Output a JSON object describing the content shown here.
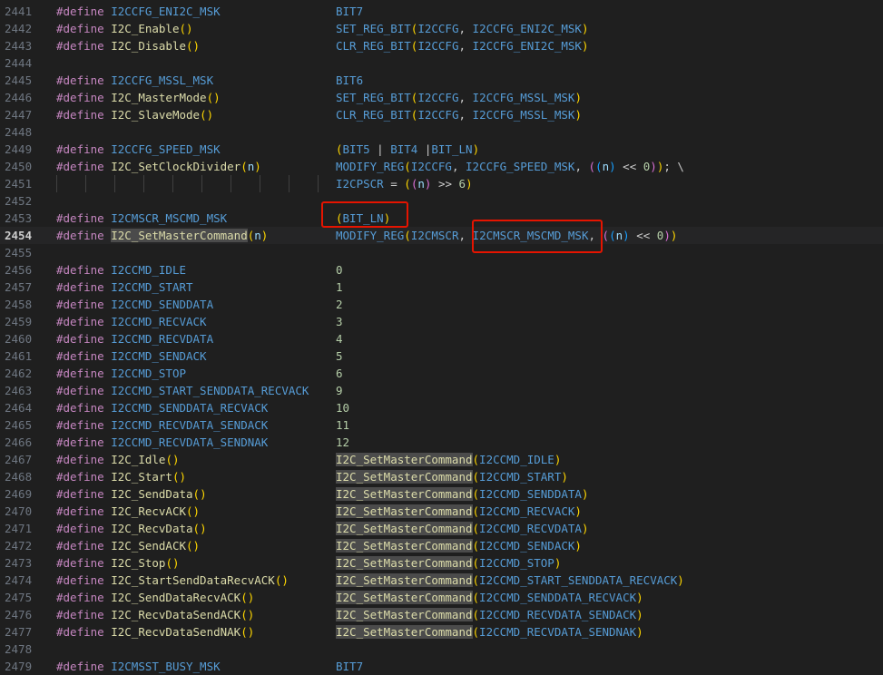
{
  "lines": [
    {
      "no": "2441",
      "name": "I2CCFG_ENI2C_MSK",
      "value": "BIT7"
    },
    {
      "no": "2442",
      "name": "I2C_Enable",
      "args": "()",
      "value": "SET_REG_BIT(I2CCFG, I2CCFG_ENI2C_MSK)"
    },
    {
      "no": "2443",
      "name": "I2C_Disable",
      "args": "()",
      "value": "CLR_REG_BIT(I2CCFG, I2CCFG_ENI2C_MSK)"
    },
    {
      "no": "2444"
    },
    {
      "no": "2445",
      "name": "I2CCFG_MSSL_MSK",
      "value": "BIT6"
    },
    {
      "no": "2446",
      "name": "I2C_MasterMode",
      "args": "()",
      "value": "SET_REG_BIT(I2CCFG, I2CCFG_MSSL_MSK)"
    },
    {
      "no": "2447",
      "name": "I2C_SlaveMode",
      "args": "()",
      "value": "CLR_REG_BIT(I2CCFG, I2CCFG_MSSL_MSK)"
    },
    {
      "no": "2448"
    },
    {
      "no": "2449",
      "name": "I2CCFG_SPEED_MSK",
      "value": "(BIT5 | BIT4 |BIT_LN)"
    },
    {
      "no": "2450",
      "name": "I2C_SetClockDivider",
      "args": "(n)",
      "value": "MODIFY_REG(I2CCFG, I2CCFG_SPEED_MSK, ((n) << 0)); \\"
    },
    {
      "no": "2451",
      "cont": "I2CPSCR = ((n) >> 6)"
    },
    {
      "no": "2452"
    },
    {
      "no": "2453",
      "name": "I2CMSCR_MSCMD_MSK",
      "value": "(BIT_LN)"
    },
    {
      "no": "2454",
      "name": "I2C_SetMasterCommand",
      "args": "(n)",
      "value": "MODIFY_REG(I2CMSCR, I2CMSCR_MSCMD_MSK, ((n) << 0))",
      "current": true
    },
    {
      "no": "2455"
    },
    {
      "no": "2456",
      "name": "I2CCMD_IDLE",
      "value": "0"
    },
    {
      "no": "2457",
      "name": "I2CCMD_START",
      "value": "1"
    },
    {
      "no": "2458",
      "name": "I2CCMD_SENDDATA",
      "value": "2"
    },
    {
      "no": "2459",
      "name": "I2CCMD_RECVACK",
      "value": "3"
    },
    {
      "no": "2460",
      "name": "I2CCMD_RECVDATA",
      "value": "4"
    },
    {
      "no": "2461",
      "name": "I2CCMD_SENDACK",
      "value": "5"
    },
    {
      "no": "2462",
      "name": "I2CCMD_STOP",
      "value": "6"
    },
    {
      "no": "2463",
      "name": "I2CCMD_START_SENDDATA_RECVACK",
      "value": "9"
    },
    {
      "no": "2464",
      "name": "I2CCMD_SENDDATA_RECVACK",
      "value": "10"
    },
    {
      "no": "2465",
      "name": "I2CCMD_RECVDATA_SENDACK",
      "value": "11"
    },
    {
      "no": "2466",
      "name": "I2CCMD_RECVDATA_SENDNAK",
      "value": "12"
    },
    {
      "no": "2467",
      "name": "I2C_Idle",
      "args": "()",
      "value": "I2C_SetMasterCommand(I2CCMD_IDLE)"
    },
    {
      "no": "2468",
      "name": "I2C_Start",
      "args": "()",
      "value": "I2C_SetMasterCommand(I2CCMD_START)"
    },
    {
      "no": "2469",
      "name": "I2C_SendData",
      "args": "()",
      "value": "I2C_SetMasterCommand(I2CCMD_SENDDATA)"
    },
    {
      "no": "2470",
      "name": "I2C_RecvACK",
      "args": "()",
      "value": "I2C_SetMasterCommand(I2CCMD_RECVACK)"
    },
    {
      "no": "2471",
      "name": "I2C_RecvData",
      "args": "()",
      "value": "I2C_SetMasterCommand(I2CCMD_RECVDATA)"
    },
    {
      "no": "2472",
      "name": "I2C_SendACK",
      "args": "()",
      "value": "I2C_SetMasterCommand(I2CCMD_SENDACK)"
    },
    {
      "no": "2473",
      "name": "I2C_Stop",
      "args": "()",
      "value": "I2C_SetMasterCommand(I2CCMD_STOP)"
    },
    {
      "no": "2474",
      "name": "I2C_StartSendDataRecvACK",
      "args": "()",
      "value": "I2C_SetMasterCommand(I2CCMD_START_SENDDATA_RECVACK)"
    },
    {
      "no": "2475",
      "name": "I2C_SendDataRecvACK",
      "args": "()",
      "value": "I2C_SetMasterCommand(I2CCMD_SENDDATA_RECVACK)"
    },
    {
      "no": "2476",
      "name": "I2C_RecvDataSendACK",
      "args": "()",
      "value": "I2C_SetMasterCommand(I2CCMD_RECVDATA_SENDACK)"
    },
    {
      "no": "2477",
      "name": "I2C_RecvDataSendNAK",
      "args": "()",
      "value": "I2C_SetMasterCommand(I2CCMD_RECVDATA_SENDNAK)"
    },
    {
      "no": "2478"
    },
    {
      "no": "2479",
      "name": "I2CMSST_BUSY_MSK",
      "value": "BIT7"
    }
  ],
  "keyword": "#define",
  "highlighted_symbol": "I2C_SetMasterCommand",
  "colors": {
    "background": "#1f1f1f",
    "keyword": "#c586c0",
    "macro": "#569cd6",
    "function": "#dcdcaa",
    "number": "#b5cea8",
    "annotation_box": "#e51400"
  }
}
